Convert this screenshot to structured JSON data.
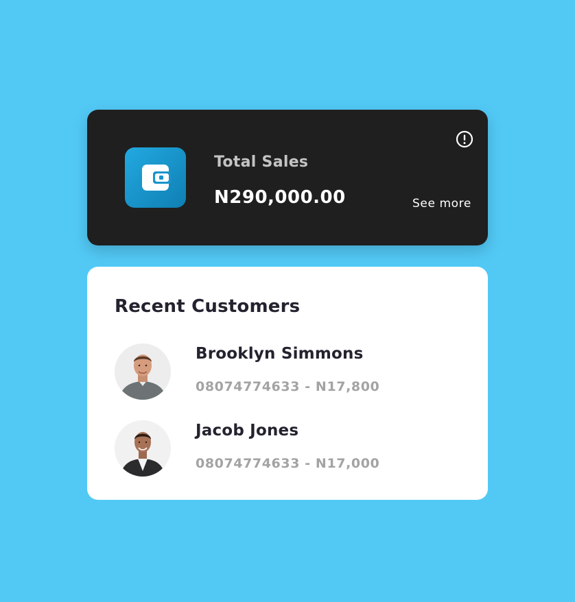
{
  "sales_card": {
    "title": "Total Sales",
    "amount": "N290,000.00",
    "see_more_label": "See more",
    "icons": {
      "wallet": "wallet-icon",
      "info": "info-icon"
    }
  },
  "customers_card": {
    "title": "Recent Customers",
    "customers": [
      {
        "name": "Brooklyn Simmons",
        "phone": "08074774633",
        "amount": "N17,800",
        "meta": "08074774633 - N17,800"
      },
      {
        "name": "Jacob Jones",
        "phone": "08074774633",
        "amount": "N17,000",
        "meta": "08074774633 - N17,000"
      }
    ]
  },
  "colors": {
    "background": "#52c9f5",
    "sales_card_bg": "#1f1f1f",
    "wallet_accent": "#1a94cb",
    "text_dark": "#23232f",
    "text_muted": "#a3a3a3"
  }
}
